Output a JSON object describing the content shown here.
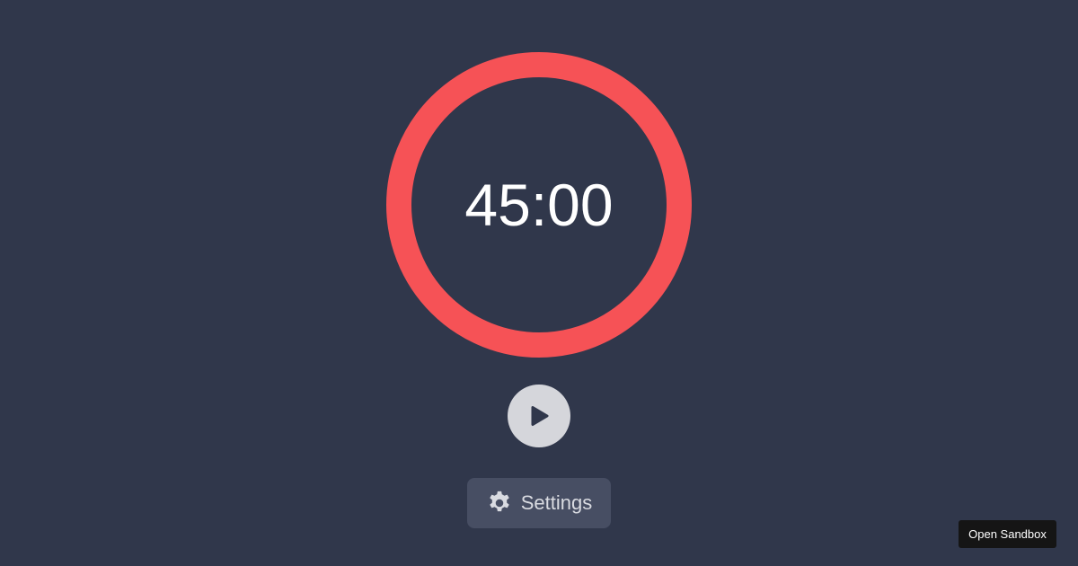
{
  "timer": {
    "display": "45:00",
    "progress_fraction": 1.0
  },
  "controls": {
    "play_icon": "play-icon",
    "settings_label": "Settings",
    "settings_icon": "gear-icon"
  },
  "footer": {
    "open_sandbox_label": "Open Sandbox"
  },
  "colors": {
    "background": "#30374b",
    "ring": "#f65256",
    "play_button_bg": "#d5d6db",
    "play_icon": "#30374b",
    "settings_bg": "#474e63",
    "settings_text": "#d9dbe1",
    "sandbox_bg": "#151515"
  }
}
